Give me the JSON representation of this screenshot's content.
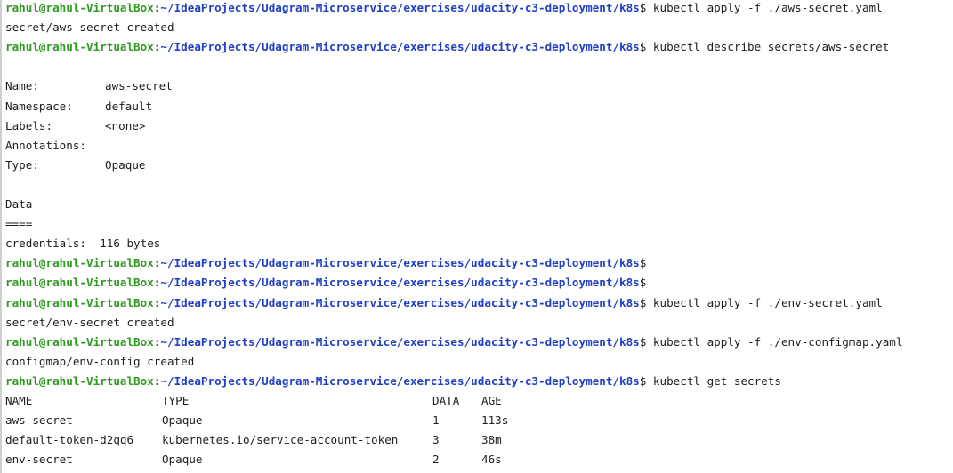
{
  "prompt": {
    "user": "rahul@rahul-VirtualBox",
    "sep": ":",
    "path": "~/IdeaProjects/Udagram-Microservice/exercises/udacity-c3-deployment/k8s",
    "dollar": "$"
  },
  "lines": [
    {
      "kind": "prompt",
      "cmd": " kubectl apply -f ./aws-secret.yaml"
    },
    {
      "kind": "text",
      "text": "secret/aws-secret created"
    },
    {
      "kind": "prompt",
      "cmd": " kubectl describe secrets/aws-secret"
    },
    {
      "kind": "text",
      "text": ""
    },
    {
      "kind": "kv",
      "key": "Name:",
      "value": "aws-secret"
    },
    {
      "kind": "kv",
      "key": "Namespace:",
      "value": "default"
    },
    {
      "kind": "kv",
      "key": "Labels:",
      "value": "<none>"
    },
    {
      "kind": "kv",
      "key": "Annotations:",
      "value": ""
    },
    {
      "kind": "kv",
      "key": "Type:",
      "value": "Opaque"
    },
    {
      "kind": "text",
      "text": ""
    },
    {
      "kind": "text",
      "text": "Data"
    },
    {
      "kind": "text",
      "text": "===="
    },
    {
      "kind": "text",
      "text": "credentials:  116 bytes"
    },
    {
      "kind": "prompt",
      "cmd": ""
    },
    {
      "kind": "prompt",
      "cmd": ""
    },
    {
      "kind": "prompt",
      "cmd": " kubectl apply -f ./env-secret.yaml"
    },
    {
      "kind": "text",
      "text": "secret/env-secret created"
    },
    {
      "kind": "prompt",
      "cmd": " kubectl apply -f ./env-configmap.yaml"
    },
    {
      "kind": "text",
      "text": "configmap/env-config created"
    },
    {
      "kind": "prompt",
      "cmd": " kubectl get secrets"
    },
    {
      "kind": "table",
      "cells": [
        "NAME",
        "TYPE",
        "DATA",
        "AGE"
      ]
    },
    {
      "kind": "table",
      "cells": [
        "aws-secret",
        "Opaque",
        "1",
        "113s"
      ]
    },
    {
      "kind": "table",
      "cells": [
        "default-token-d2qq6",
        "kubernetes.io/service-account-token",
        "3",
        "38m"
      ]
    },
    {
      "kind": "table",
      "cells": [
        "env-secret",
        "Opaque",
        "2",
        "46s"
      ]
    }
  ],
  "colors": {
    "user": "#2e9a1f",
    "path": "#1f3fc4",
    "text": "#1e1e1e",
    "background": "#ffffff"
  }
}
